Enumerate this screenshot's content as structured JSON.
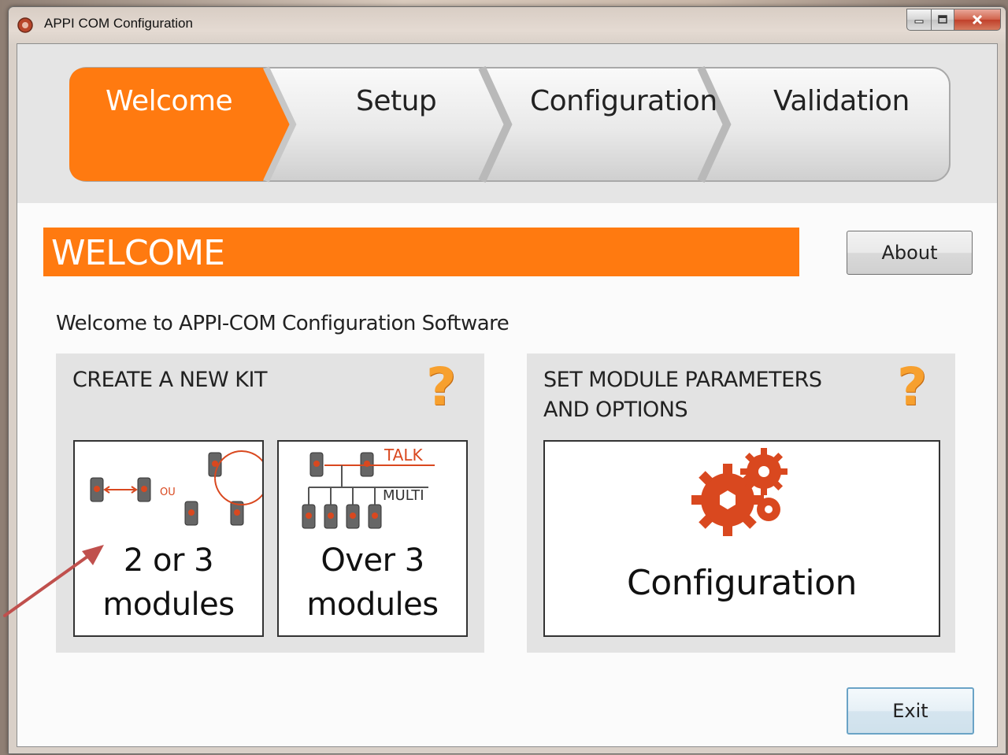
{
  "window": {
    "title": "APPI COM Configuration"
  },
  "steps": [
    {
      "label": "Welcome",
      "active": true
    },
    {
      "label": "Setup",
      "active": false
    },
    {
      "label": "Configuration",
      "active": false
    },
    {
      "label": "Validation",
      "active": false
    }
  ],
  "banner": {
    "title": "WELCOME"
  },
  "about_label": "About",
  "intro_text": "Welcome to APPI-COM Configuration Software",
  "new_kit": {
    "title": "CREATE A NEW KIT",
    "help": "?",
    "options": [
      {
        "line1": "2 or 3",
        "line2": "modules",
        "ou": "OU"
      },
      {
        "line1": "Over 3",
        "line2": "modules",
        "talk": "TALK",
        "multi": "MULTI"
      }
    ]
  },
  "module_params": {
    "title_line1": "SET MODULE PARAMETERS",
    "title_line2": "AND OPTIONS",
    "help": "?",
    "button_label": "Configuration"
  },
  "exit_label": "Exit",
  "colors": {
    "accent": "#ff7a10",
    "gear": "#d9481f"
  }
}
